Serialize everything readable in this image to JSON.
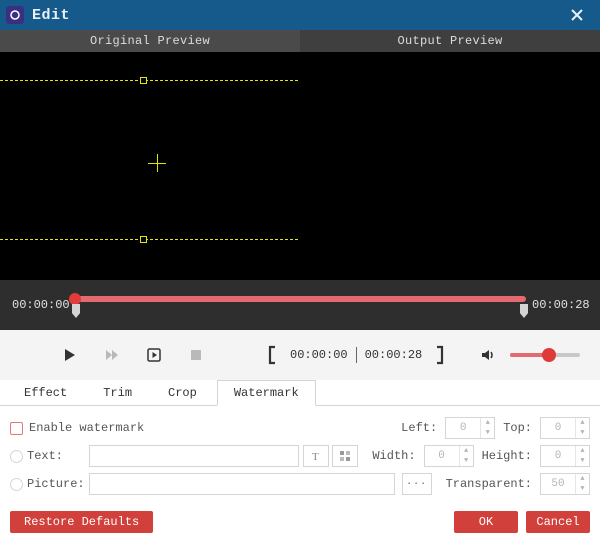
{
  "colors": {
    "titlebar": "#165a8b",
    "accent_red": "#d2403c",
    "scrub_red": "#e46a72",
    "crop_yellow": "#e6e600"
  },
  "titlebar": {
    "title": "Edit"
  },
  "preview": {
    "original_label": "Original Preview",
    "output_label": "Output Preview"
  },
  "timeline": {
    "current": "00:00:00",
    "duration": "00:00:28"
  },
  "range": {
    "start": "00:00:00",
    "end": "00:00:28"
  },
  "volume": {
    "percent": 55
  },
  "tabs": {
    "items": [
      {
        "label": "Effect"
      },
      {
        "label": "Trim"
      },
      {
        "label": "Crop"
      },
      {
        "label": "Watermark"
      }
    ],
    "active": 3
  },
  "watermark": {
    "enable_label": "Enable watermark",
    "text_label": "Text:",
    "picture_label": "Picture:",
    "left_label": "Left:",
    "top_label": "Top:",
    "width_label": "Width:",
    "height_label": "Height:",
    "transparent_label": "Transparent:",
    "text_value": "",
    "picture_value": "",
    "left": 0,
    "top": 0,
    "width": 0,
    "height": 0,
    "transparent": 50,
    "browse_label": "···"
  },
  "buttons": {
    "restore": "Restore Defaults",
    "ok": "OK",
    "cancel": "Cancel"
  }
}
